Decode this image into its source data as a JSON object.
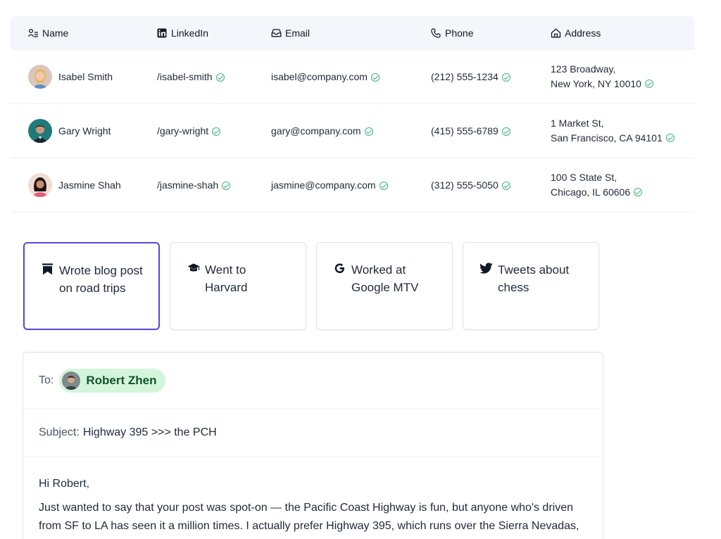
{
  "table": {
    "headers": {
      "name": "Name",
      "linkedin": "LinkedIn",
      "email": "Email",
      "phone": "Phone",
      "address": "Address"
    },
    "rows": [
      {
        "name": "Isabel Smith",
        "linkedin": "/isabel-smith",
        "email": "isabel@company.com",
        "phone": "(212) 555-1234",
        "address_line1": "123 Broadway,",
        "address_line2": "New York, NY 10010"
      },
      {
        "name": "Gary Wright",
        "linkedin": "/gary-wright",
        "email": "gary@company.com",
        "phone": "(415) 555-6789",
        "address_line1": "1 Market St,",
        "address_line2": "San Francisco, CA 94101"
      },
      {
        "name": "Jasmine Shah",
        "linkedin": "/jasmine-shah",
        "email": "jasmine@company.com",
        "phone": "(312) 555-5050",
        "address_line1": "100 S State St,",
        "address_line2": "Chicago, IL 60606"
      }
    ],
    "verified_color": "#3fb37f"
  },
  "cards": [
    {
      "icon": "bookmark-icon",
      "text": "Wrote blog post on road trips",
      "selected": true
    },
    {
      "icon": "graduation-cap-icon",
      "text": "Went to Harvard",
      "selected": false
    },
    {
      "icon": "google-icon",
      "text": "Worked at Google MTV",
      "selected": false
    },
    {
      "icon": "twitter-icon",
      "text": "Tweets about chess",
      "selected": false
    }
  ],
  "composer": {
    "to_label": "To:",
    "recipient": "Robert Zhen",
    "subject_label": "Subject:",
    "subject": "Highway 395 >>> the PCH",
    "greeting": "Hi Robert,",
    "body": "Just wanted to say that your post was spot-on — the Pacific Coast Highway is fun, but anyone who's driven from SF to LA has seen it a million times. I actually prefer Highway 395, which runs over the Sierra Nevadas, past Lake Tahoe. Once you pass over and the drive gets you right off the high..."
  },
  "colors": {
    "accent": "#5b46d6",
    "chip_bg": "#d3f5dc",
    "chip_text": "#14532d",
    "header_bg": "#f3f6fa"
  }
}
